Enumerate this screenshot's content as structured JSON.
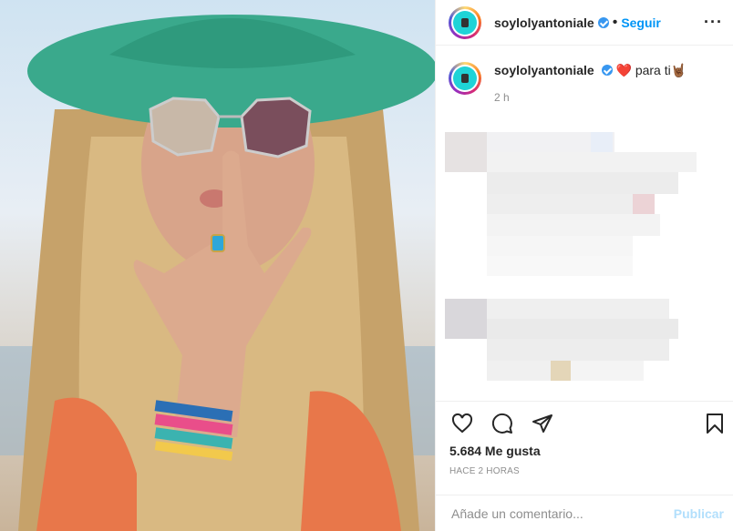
{
  "post": {
    "username": "soylolyantoniale",
    "follow_label": "Seguir",
    "more_glyph": "···",
    "caption_heart": "❤️",
    "caption_text": "para ti",
    "caption_emoji": "🤘🏾",
    "caption_time": "2 h",
    "likes": "5.684 Me gusta",
    "time_ago": "HACE 2 HORAS"
  },
  "comment": {
    "placeholder": "Añade un comentario...",
    "publish_label": "Publicar"
  },
  "icons": [
    "heart-icon",
    "comment-icon",
    "share-icon",
    "bookmark-icon",
    "verified-badge-icon",
    "more-icon"
  ],
  "colors": {
    "follow": "#0095f6",
    "publish_disabled": "#b2dffc",
    "verified": "#3897f0"
  }
}
